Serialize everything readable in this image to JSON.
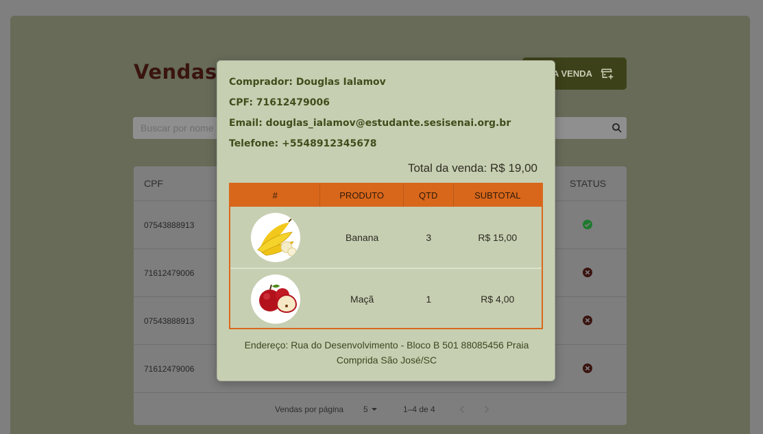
{
  "page": {
    "title": "Vendas C",
    "new_sale_label": "NOVA VENDA",
    "search_placeholder": "Buscar por nome"
  },
  "table": {
    "headers": {
      "cpf": "CPF",
      "status": "STATUS"
    },
    "rows": [
      {
        "cpf": "07543888913",
        "status": "ok"
      },
      {
        "cpf": "71612479006",
        "status": "cancel"
      },
      {
        "cpf": "07543888913",
        "status": "cancel"
      },
      {
        "cpf": "71612479006",
        "status": "cancel"
      }
    ],
    "footer": {
      "per_page_label": "Vendas por página",
      "per_page_value": "5",
      "range": "1–4 de 4"
    }
  },
  "modal": {
    "comprador": "Comprador: Douglas Ialamov",
    "cpf": "CPF: 71612479006",
    "email": "Email: douglas_ialamov@estudante.sesisenai.org.br",
    "telefone": "Telefone: +5548912345678",
    "total": "Total da venda: R$ 19,00",
    "headers": {
      "num": "#",
      "produto": "PRODUTO",
      "qtd": "QTD",
      "subtotal": "SUBTOTAL"
    },
    "items": [
      {
        "produto": "Banana",
        "qtd": "3",
        "subtotal": "R$ 15,00",
        "image_icon": "banana-image"
      },
      {
        "produto": "Maçã",
        "qtd": "1",
        "subtotal": "R$ 4,00",
        "image_icon": "apple-image"
      }
    ],
    "address": "Endereço: Rua do Desenvolvimento - Bloco B 501 88085456 Praia Comprida São José/SC"
  },
  "colors": {
    "accent_orange": "#d8671b",
    "modal_bg": "#c7cfb2",
    "status_ok": "#1e7a2e",
    "status_cancel": "#3a1410",
    "button_bg": "#3d4119"
  }
}
